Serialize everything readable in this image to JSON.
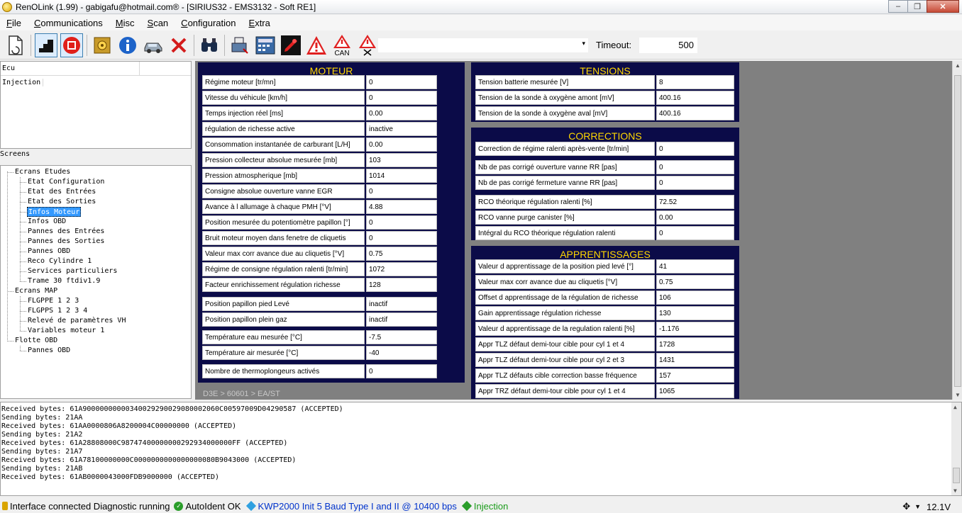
{
  "window": {
    "title": "RenOLink (1.99) - gabigafu@hotmail.com® -  [SIRIUS32 - EMS3132 - Soft RE1]"
  },
  "menu": [
    "File",
    "Communications",
    "Misc",
    "Scan",
    "Configuration",
    "Extra"
  ],
  "toolbar": {
    "icons": [
      "new-document-icon",
      "connect-stairs-icon",
      "stop-icon",
      "ecu-settings-icon",
      "info-icon",
      "car-icon",
      "close-x-icon",
      "binoculars-icon",
      "flash-icon",
      "calculator-icon",
      "pen-icon",
      "warning-icon",
      "warning-can-icon",
      "warning-clear-icon"
    ],
    "can_label": "CAN",
    "timeout_label": "Timeout:",
    "timeout_value": "500",
    "combo_value": ""
  },
  "ecu": {
    "header": "Ecu",
    "item": "Injection"
  },
  "screens": {
    "label": "Screens",
    "tree": [
      {
        "label": "Ecrans Etudes",
        "level": 1
      },
      {
        "label": "Etat Configuration",
        "level": 2
      },
      {
        "label": "Etat des Entrées",
        "level": 2
      },
      {
        "label": "Etat des Sorties",
        "level": 2
      },
      {
        "label": "Infos Moteur",
        "level": 2,
        "selected": true
      },
      {
        "label": "Infos OBD",
        "level": 2
      },
      {
        "label": "Pannes des Entrées",
        "level": 2
      },
      {
        "label": "Pannes des Sorties",
        "level": 2
      },
      {
        "label": "Pannes OBD",
        "level": 2
      },
      {
        "label": "Reco Cylindre 1",
        "level": 2
      },
      {
        "label": "Services particuliers",
        "level": 2
      },
      {
        "label": "Trame 30 ftdiv1.9",
        "level": 2
      },
      {
        "label": "Ecrans MAP",
        "level": 1
      },
      {
        "label": "FLGPPE 1 2 3",
        "level": 2
      },
      {
        "label": "FLGPPS 1 2 3 4",
        "level": 2
      },
      {
        "label": "Relevé de paramètres VH",
        "level": 2
      },
      {
        "label": "Variables moteur 1",
        "level": 2
      },
      {
        "label": "Flotte OBD",
        "level": 1
      },
      {
        "label": "Pannes OBD",
        "level": 2
      }
    ]
  },
  "moteur": {
    "title": "MOTEUR",
    "rows": [
      {
        "label": "Régime moteur [tr/mn]",
        "value": "0"
      },
      {
        "label": "Vitesse du véhicule [km/h]",
        "value": "0"
      },
      {
        "label": "Temps injection réel [ms]",
        "value": "0.00"
      },
      {
        "label": "régulation de richesse active",
        "value": "inactive"
      },
      {
        "label": "Consommation instantanée de carburant [L/H]",
        "value": "0.00"
      },
      {
        "label": "Pression collecteur absolue mesurée [mb]",
        "value": "103"
      },
      {
        "label": "Pression atmospherique [mb]",
        "value": "1014"
      },
      {
        "label": "Consigne absolue ouverture vanne EGR",
        "value": "0"
      },
      {
        "label": "Avance à l allumage à chaque PMH [°V]",
        "value": "4.88"
      },
      {
        "label": "Position mesurée du potentiomètre papillon [°]",
        "value": "0"
      },
      {
        "label": "Bruit moteur moyen dans fenetre de cliquetis",
        "value": "0"
      },
      {
        "label": "Valeur max corr avance due au cliquetis [°V]",
        "value": "0.75"
      },
      {
        "label": "Régime de consigne régulation ralenti [tr/min]",
        "value": "1072"
      },
      {
        "label": "Facteur enrichissement régulation richesse",
        "value": "128"
      },
      {
        "label": "Position papillon pied Levé",
        "value": "inactif"
      },
      {
        "label": "Position papillon plein gaz",
        "value": "inactif"
      },
      {
        "label": "Température eau mesurée [°C]",
        "value": "-7.5"
      },
      {
        "label": "Température air mesurée [°C]",
        "value": "-40"
      },
      {
        "label": "Nombre de thermoplongeurs activés",
        "value": "0"
      }
    ]
  },
  "tensions": {
    "title": "TENSIONS",
    "rows": [
      {
        "label": "Tension batterie mesurée [V]",
        "value": "8"
      },
      {
        "label": "Tension de la sonde à oxygène amont [mV]",
        "value": "400.16"
      },
      {
        "label": "Tension de la sonde à oxygène aval [mV]",
        "value": "400.16"
      }
    ]
  },
  "corrections": {
    "title": "CORRECTIONS",
    "rows": [
      {
        "label": "Correction de régime ralenti après-vente [tr/min]",
        "value": "0"
      },
      {
        "label": "Nb de pas corrigé ouverture vanne RR [pas]",
        "value": "0"
      },
      {
        "label": "Nb de pas corrigé fermeture vanne RR [pas]",
        "value": "0"
      },
      {
        "label": "RCO théorique régulation ralenti [%]",
        "value": "72.52"
      },
      {
        "label": "RCO vanne purge canister [%]",
        "value": "0.00"
      },
      {
        "label": "Intégral du RCO théorique régulation ralenti",
        "value": "0"
      }
    ]
  },
  "apprentissages": {
    "title": "APPRENTISSAGES",
    "rows": [
      {
        "label": "Valeur d apprentissage de la position pied levé [°]",
        "value": "41"
      },
      {
        "label": "Valeur max corr avance due au cliquetis [°V]",
        "value": "0.75"
      },
      {
        "label": "Offset d apprentissage de la régulation de richesse",
        "value": "106"
      },
      {
        "label": "Gain apprentissage régulation richesse",
        "value": "130"
      },
      {
        "label": "Valeur d apprentissage de la regulation ralenti [%]",
        "value": "-1.176"
      },
      {
        "label": "Appr TLZ défaut demi-tour cible pour cyl 1 et 4",
        "value": "1728"
      },
      {
        "label": "Appr TLZ défaut demi-tour cible pour cyl 2 et 3",
        "value": "1431"
      },
      {
        "label": "Appr TLZ défauts cible correction basse fréquence",
        "value": "157"
      },
      {
        "label": "Appr TRZ défaut demi-tour cible pour cyl 1 et 4",
        "value": "1065"
      }
    ]
  },
  "breadcrumb": "D3E > 60601 > EA/ST",
  "log": [
    "Received bytes: 61A90000000000340029290029080002060C00597009D04290587 (ACCEPTED)",
    "Sending bytes: 21AA",
    "Received bytes: 61AA0000806A8200004C00000000 (ACCEPTED)",
    "Sending bytes: 21A2",
    "Received bytes: 61A28808000C98747400000000292934000000FF (ACCEPTED)",
    "Sending bytes: 21A7",
    "Received bytes: 61A78100000000C0000000000000000080B9043000 (ACCEPTED)",
    "Sending bytes: 21AB",
    "Received bytes: 61AB0000043000FDB9000000 (ACCEPTED)"
  ],
  "status": {
    "interface": "Interface connected Diagnostic running",
    "autoident": "AutoIdent OK",
    "protocol": "KWP2000 Init 5 Baud Type I and II @ 10400 bps",
    "ecu": "Injection",
    "voltage": "12.1V",
    "colors": {
      "protocol": "#0033cc",
      "ecu": "#1a9b1a",
      "panel": "#0b0b48",
      "title": "#ffd700"
    }
  }
}
